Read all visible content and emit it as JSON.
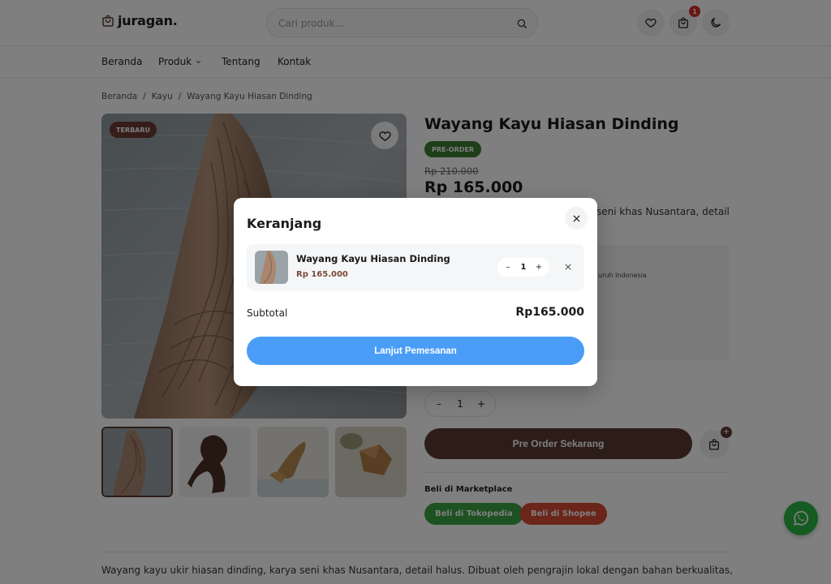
{
  "brand": {
    "name": "juragan."
  },
  "search": {
    "placeholder": "Cari produk..."
  },
  "header": {
    "cart_count": "1"
  },
  "nav": {
    "items": [
      "Beranda",
      "Produk",
      "Tentang",
      "Kontak"
    ]
  },
  "breadcrumb": [
    "Beranda",
    "/",
    "Kayu",
    "/",
    "Wayang Kayu Hiasan Dinding"
  ],
  "gallery": {
    "badge": "TERBARU"
  },
  "product": {
    "title": "Wayang Kayu Hiasan Dinding",
    "status_badge": "PRE-ORDER",
    "old_price": "Rp 210.000",
    "price": "Rp 165.000",
    "desc_snippet": "seni khas Nusantara, detail",
    "info_snippet": "uruh Indonesia",
    "quantity": "1",
    "preorder_label": "Pre Order Sekarang",
    "add_cart_badge": "+",
    "marketplace_label": "Beli di Marketplace",
    "tokopedia_label": "Beli di Tokopedia",
    "shopee_label": "Beli di Shopee",
    "long_description": "Wayang kayu ukir hiasan dinding, karya seni khas Nusantara, detail halus. Dibuat oleh pengrajin lokal dengan bahan berkualitas, setiap"
  },
  "cart_modal": {
    "title": "Keranjang",
    "item": {
      "name": "Wayang Kayu Hiasan Dinding",
      "price": "Rp 165.000",
      "quantity": "1"
    },
    "subtotal_label": "Subtotal",
    "subtotal_value": "Rp165.000",
    "checkout_label": "Lanjut Pemesanan"
  },
  "colors": {
    "brand_brown": "#5b3a33",
    "preorder_green": "#3d7a32",
    "tokopedia_green": "#3da544",
    "shopee_red": "#d94a33",
    "checkout_blue": "#4a9df6",
    "whatsapp_green": "#2db742"
  }
}
